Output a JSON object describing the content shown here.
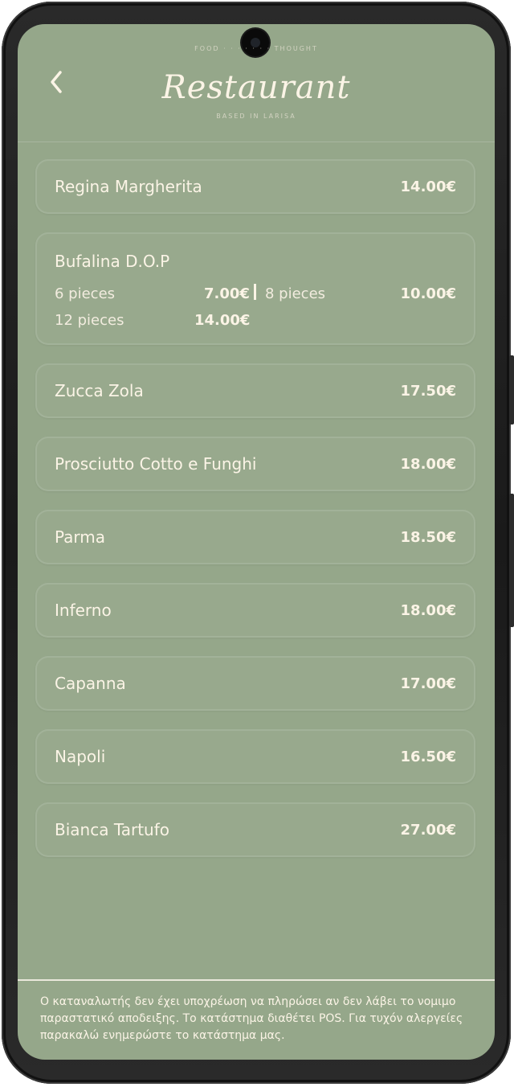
{
  "header": {
    "logo_top_text": "FOOD · · · · · · · THOUGHT",
    "logo_word": "Restaurant",
    "logo_bottom_text": "BASED IN LARISA"
  },
  "menu": [
    {
      "name": "Regina Margherita",
      "price": "14.00€"
    },
    {
      "name": "Bufalina D.O.P",
      "options": [
        {
          "label": "6 pieces",
          "price": "7.00€"
        },
        {
          "label": "8 pieces",
          "price": "10.00€"
        },
        {
          "label": "12 pieces",
          "price": "14.00€"
        }
      ]
    },
    {
      "name": "Zucca Zola",
      "price": "17.50€"
    },
    {
      "name": "Prosciutto Cotto e Funghi",
      "price": "18.00€"
    },
    {
      "name": "Parma",
      "price": "18.50€"
    },
    {
      "name": "Inferno",
      "price": "18.00€"
    },
    {
      "name": "Capanna",
      "price": "17.00€"
    },
    {
      "name": "Napoli",
      "price": "16.50€"
    },
    {
      "name": "Bianca Tartufo",
      "price": "27.00€"
    }
  ],
  "footer": {
    "notice": "Ο καταναλωτής δεν έχει υποχρέωση να πληρώσει αν δεν λάβει το νομιμο παραστατικό αποδειξης. Το κατάστημα διαθέτει POS. Για τυχόν αλεργείες παρακαλώ ενημερώστε το κατάστημα μας."
  },
  "colors": {
    "background": "#95a78a",
    "text": "#fbf4e6"
  },
  "icons": {
    "back": "chevron-left-icon",
    "camera": "front-camera"
  }
}
